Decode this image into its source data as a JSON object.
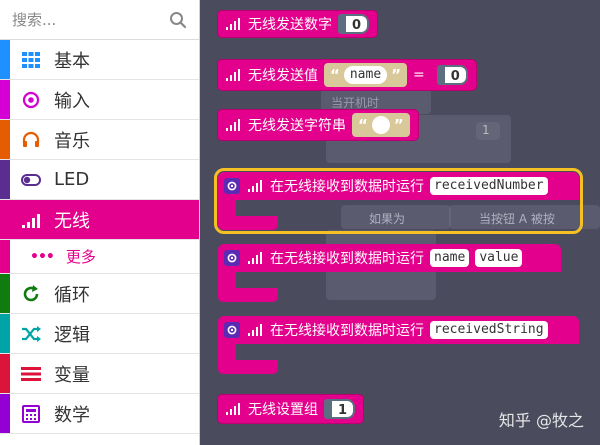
{
  "search": {
    "placeholder": "搜索..."
  },
  "categories": [
    {
      "label": "基本",
      "color": "#1e90ff",
      "icon": "grid-icon"
    },
    {
      "label": "输入",
      "color": "#d400d4",
      "icon": "target-icon"
    },
    {
      "label": "音乐",
      "color": "#e65c00",
      "icon": "headphones-icon"
    },
    {
      "label": "LED",
      "color": "#5c2d91",
      "icon": "toggle-icon"
    },
    {
      "label": "无线",
      "color": "#e3008c",
      "icon": "signal-icon"
    },
    {
      "label": "循环",
      "color": "#107c10",
      "icon": "refresh-icon"
    },
    {
      "label": "逻辑",
      "color": "#00a4a6",
      "icon": "shuffle-icon"
    },
    {
      "label": "变量",
      "color": "#dc143c",
      "icon": "list-icon"
    },
    {
      "label": "数学",
      "color": "#9400d3",
      "icon": "calculator-icon"
    }
  ],
  "sub_item": {
    "label": "更多"
  },
  "blocks": {
    "send_number": {
      "label": "无线发送数字",
      "value": "0"
    },
    "send_value": {
      "label": "无线发送值",
      "name": "name",
      "eq": "=",
      "value": "0",
      "quote_open": "“",
      "quote_close": "”"
    },
    "send_string": {
      "label": "无线发送字符串",
      "value": "",
      "quote_open": "“",
      "quote_close": "”"
    },
    "on_received_number": {
      "label": "在无线接收到数据时运行",
      "param": "receivedNumber"
    },
    "on_received_value": {
      "label": "在无线接收到数据时运行",
      "param1": "name",
      "param2": "value"
    },
    "on_received_string": {
      "label": "在无线接收到数据时运行",
      "param": "receivedString"
    },
    "set_group": {
      "label": "无线设置组",
      "value": "1"
    }
  },
  "ghost_text": {
    "start": "当开机时",
    "if": "如果为",
    "button": "当按钮",
    "button_key": "A",
    "pressed": "被按",
    "num": "1"
  },
  "watermark": "知乎 @牧之"
}
